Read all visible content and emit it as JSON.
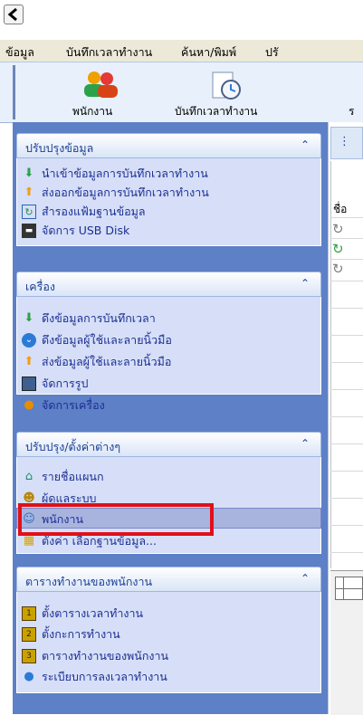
{
  "window": {
    "back_icon": "back-arrow-icon"
  },
  "menu": [
    "ข้อมูล",
    "บันทึกเวลาทำงาน",
    "ค้นหา/พิมพ์",
    "ปรั"
  ],
  "toolbar": {
    "buttons": [
      {
        "label": "พนักงาน",
        "icon": "employees-icon"
      },
      {
        "label": "บันทึกเวลาทำงาน",
        "icon": "clock-page-icon"
      }
    ],
    "partial_label": "ร"
  },
  "panels": [
    {
      "title": "ปรับปรุงข้อมูล",
      "items": [
        {
          "label": "นำเข้าข้อมูลการบันทึกเวลาทำงาน",
          "icon": "import-down-arrow-icon"
        },
        {
          "label": "ส่งออกข้อมูลการบันทึกเวลาทำงาน",
          "icon": "export-up-arrow-icon"
        },
        {
          "label": "สำรองแฟ้มฐานข้อมูล",
          "icon": "backup-icon"
        },
        {
          "label": "จัดการ USB Disk",
          "icon": "usb-disk-icon"
        }
      ]
    },
    {
      "title": "เครื่อง",
      "items": [
        {
          "label": "ดึงข้อมูลการบันทึกเวลา",
          "icon": "download-arrow-icon"
        },
        {
          "label": "ดึงข้อมูลผู้ใช้และลายนิ้วมือ",
          "icon": "download-circle-icon"
        },
        {
          "label": "ส่งข้อมูลผู้ใช้และลายนิ้วมือ",
          "icon": "upload-arrow-icon"
        },
        {
          "label": "จัดการรูป",
          "icon": "image-icon"
        },
        {
          "label": "จัดการเครื่อง",
          "icon": "device-users-icon"
        }
      ]
    },
    {
      "title": "ปรับปรุง/ตั้งค่าต่างๆ",
      "items": [
        {
          "label": "รายชื่อแผนก",
          "icon": "department-icon"
        },
        {
          "label": "ผู้ดูแลระบบ",
          "icon": "admin-icon"
        },
        {
          "label": "พนักงาน",
          "icon": "employee-icon",
          "selected": true
        },
        {
          "label": "ตั้งค่า เลือกฐานข้อมูล...",
          "icon": "database-settings-icon"
        }
      ]
    },
    {
      "title": "ตารางทำงานของพนักงาน",
      "items": [
        {
          "label": "ตั้งตารางเวลาทำงาน",
          "icon": "schedule-1-icon"
        },
        {
          "label": "ตั้งกะการทำงาน",
          "icon": "schedule-2-icon"
        },
        {
          "label": "ตารางทำงานของพนักงาน",
          "icon": "schedule-3-icon"
        },
        {
          "label": "ระเบียบการลงเวลาทำงาน",
          "icon": "rule-circle-icon"
        }
      ]
    }
  ],
  "right_pane": {
    "tab_glyph": "⋮",
    "partial_header": "ชื่อ",
    "rows_icons": [
      "refresh-icon",
      "refresh-green-icon",
      "refresh-icon"
    ]
  },
  "colors": {
    "sidebar_bg": "#5d80c6",
    "panel_bg": "#d6dff7",
    "task_text": "#1d2f94",
    "highlight_box": "#e0101a"
  }
}
